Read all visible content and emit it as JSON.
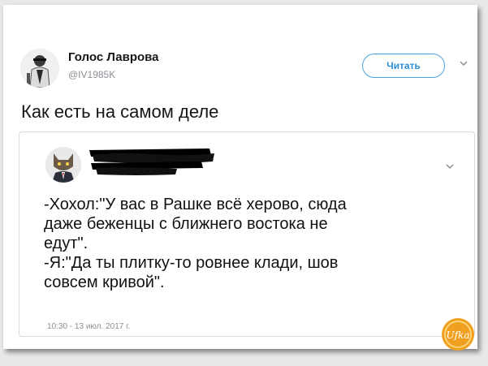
{
  "tweet": {
    "author_name": "Голос Лаврова",
    "author_handle": "@IV1985K",
    "follow_label": "Читать",
    "text": "Как есть на самом деле"
  },
  "quoted": {
    "lines": [
      "-Хохол:\"У вас в Рашке всё херово, сюда",
      "даже беженцы с ближнего востока не",
      "едут\".",
      "-Я:\"Да ты плитку-то ровнее клади, шов",
      "совсем кривой\"."
    ],
    "timestamp": "10:30 - 13 июл. 2017 г."
  },
  "watermark": {
    "text": "Ufka"
  },
  "colors": {
    "accent": "#2b8fd6",
    "watermark": "#f0a020"
  }
}
